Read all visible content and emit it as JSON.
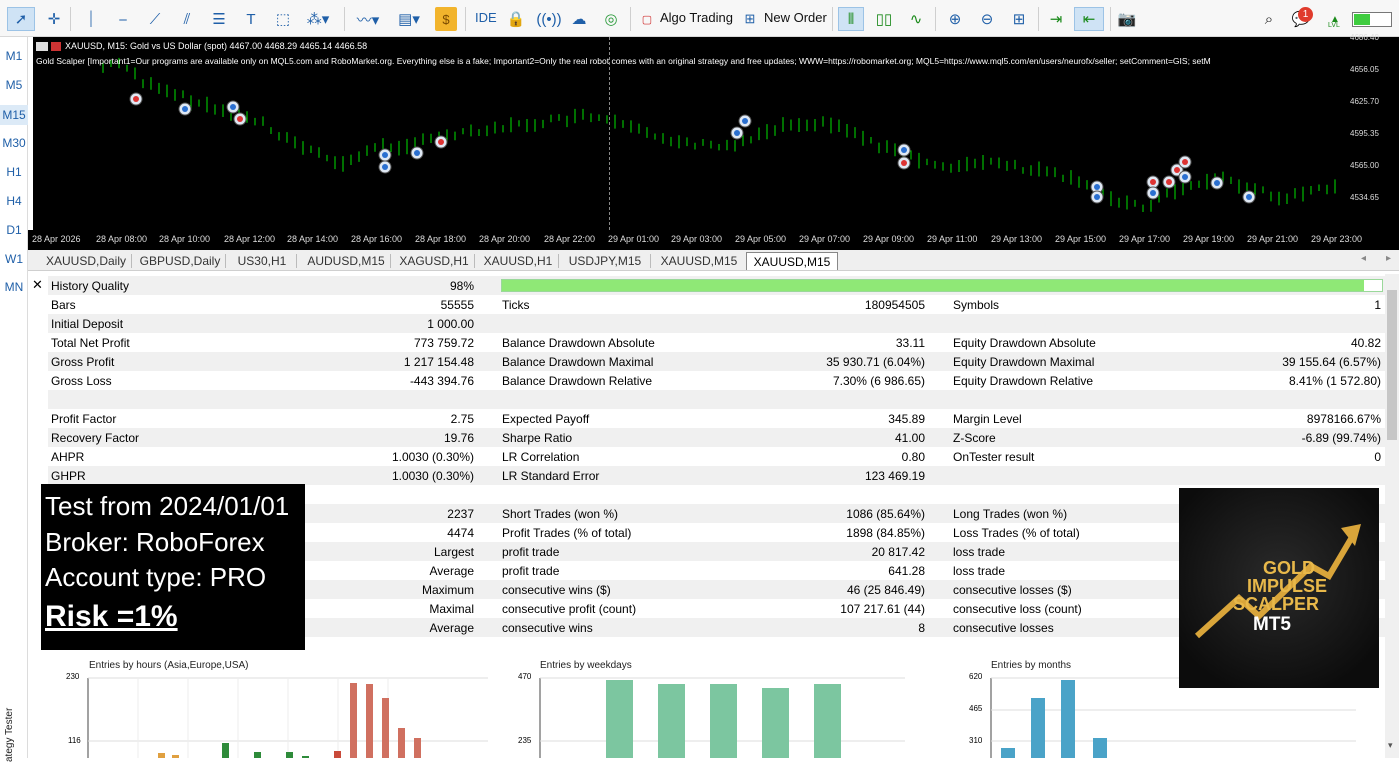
{
  "toolbar": {
    "algo_trading_label": "Algo Trading",
    "new_order_label": "New Order",
    "ide_label": "IDE",
    "notification_count": "1",
    "lvl_label": "LVL"
  },
  "timeframes": [
    "M1",
    "M5",
    "M15",
    "M30",
    "H1",
    "H4",
    "D1",
    "W1",
    "MN"
  ],
  "chart": {
    "header": "XAUUSD, M15:  Gold vs US Dollar (spot)  4467.00 4468.29 4465.14 4466.58",
    "comment": "Gold Scalper [Important1=Our programs are available only on MQL5.com and RoboMarket.org. Everything else is a fake; Important2=Only the real robot comes with an original strategy and free updates; WWW=https://robomarket.org; MQL5=https://www.mql5.com/en/users/neurofx/seller; setComment=GIS; setM",
    "prices": [
      "4686.40",
      "4656.05",
      "4625.70",
      "4595.35",
      "4565.00",
      "4534.65"
    ],
    "times": [
      "28 Apr 2026",
      "28 Apr 08:00",
      "28 Apr 10:00",
      "28 Apr 12:00",
      "28 Apr 14:00",
      "28 Apr 16:00",
      "28 Apr 18:00",
      "28 Apr 20:00",
      "28 Apr 22:00",
      "29 Apr 01:00",
      "29 Apr 03:00",
      "29 Apr 05:00",
      "29 Apr 07:00",
      "29 Apr 09:00",
      "29 Apr 11:00",
      "29 Apr 13:00",
      "29 Apr 15:00",
      "29 Apr 17:00",
      "29 Apr 19:00",
      "29 Apr 21:00",
      "29 Apr 23:00"
    ],
    "bull_color": "#00e000",
    "bg_color": "#000000"
  },
  "tabs": [
    "XAUUSD,Daily",
    "GBPUSD,Daily",
    "US30,H1",
    "AUDUSD,M15",
    "XAGUSD,H1",
    "XAUUSD,H1",
    "USDJPY,M15",
    "XAUUSD,M15",
    "XAUUSD,M15"
  ],
  "report": {
    "history_quality": {
      "label": "History Quality",
      "value": "98%",
      "fraction": 0.98
    },
    "rows": [
      {
        "c1": "Bars",
        "v1": "55555",
        "c2": "Ticks",
        "v2": "180954505",
        "c3": "Symbols",
        "v3": "1"
      },
      {
        "c1": "Initial Deposit",
        "v1": "1 000.00",
        "c2": "",
        "v2": "",
        "c3": "",
        "v3": ""
      },
      {
        "c1": "Total Net Profit",
        "v1": "773 759.72",
        "c2": "Balance Drawdown Absolute",
        "v2": "33.11",
        "c3": "Equity Drawdown Absolute",
        "v3": "40.82"
      },
      {
        "c1": "Gross Profit",
        "v1": "1 217 154.48",
        "c2": "Balance Drawdown Maximal",
        "v2": "35 930.71 (6.04%)",
        "c3": "Equity Drawdown Maximal",
        "v3": "39 155.64 (6.57%)"
      },
      {
        "c1": "Gross Loss",
        "v1": "-443 394.76",
        "c2": "Balance Drawdown Relative",
        "v2": "7.30% (6 986.65)",
        "c3": "Equity Drawdown Relative",
        "v3": "8.41% (1 572.80)"
      },
      {
        "c1": "",
        "v1": "",
        "c2": "",
        "v2": "",
        "c3": "",
        "v3": ""
      },
      {
        "c1": "Profit Factor",
        "v1": "2.75",
        "c2": "Expected Payoff",
        "v2": "345.89",
        "c3": "Margin Level",
        "v3": "8978166.67%"
      },
      {
        "c1": "Recovery Factor",
        "v1": "19.76",
        "c2": "Sharpe Ratio",
        "v2": "41.00",
        "c3": "Z-Score",
        "v3": "-6.89 (99.74%)"
      },
      {
        "c1": "AHPR",
        "v1": "1.0030 (0.30%)",
        "c2": "LR Correlation",
        "v2": "0.80",
        "c3": "OnTester result",
        "v3": "0"
      },
      {
        "c1": "GHPR",
        "v1": "1.0030 (0.30%)",
        "c2": "LR Standard Error",
        "v2": "123 469.19",
        "c3": "",
        "v3": ""
      },
      {
        "c1": "",
        "v1": "",
        "c2": "",
        "v2": "",
        "c3": "",
        "v3": ""
      },
      {
        "c1": "",
        "v1": "2237",
        "c2": "Short Trades (won %)",
        "v2": "1086 (85.64%)",
        "c3": "Long Trades (won %)",
        "v3": ""
      },
      {
        "c1": "",
        "v1": "4474",
        "c2": "Profit Trades (% of total)",
        "v2": "1898 (84.85%)",
        "c3": "Loss Trades (% of total)",
        "v3": ""
      },
      {
        "c1": "",
        "v1": "Largest",
        "c2": "profit trade",
        "v2": "20 817.42",
        "c3": "loss trade",
        "v3": ""
      },
      {
        "c1": "",
        "v1": "Average",
        "c2": "profit trade",
        "v2": "641.28",
        "c3": "loss trade",
        "v3": ""
      },
      {
        "c1": "",
        "v1": "Maximum",
        "c2": "consecutive wins ($)",
        "v2": "46 (25 846.49)",
        "c3": "consecutive losses ($)",
        "v3": ""
      },
      {
        "c1": "",
        "v1": "Maximal",
        "c2": "consecutive profit (count)",
        "v2": "107 217.61 (44)",
        "c3": "consecutive loss (count)",
        "v3": ""
      },
      {
        "c1": "",
        "v1": "Average",
        "c2": "consecutive wins",
        "v2": "8",
        "c3": "consecutive losses",
        "v3": ""
      }
    ]
  },
  "overlay": {
    "line1": "Test from 2024/01/01",
    "line2": "Broker: RoboForex",
    "line3": "Account type: PRO",
    "line4": "Risk =1%"
  },
  "logo": {
    "line1": "GOLD",
    "line2": "IMPULSE",
    "line3": "SCALPER",
    "line4": "MT5",
    "gold_color": "#e8b84a"
  },
  "mini_charts": [
    {
      "title": "Entries by hours (Asia,Europe,USA)",
      "ticks": [
        "230",
        "116"
      ]
    },
    {
      "title": "Entries by weekdays",
      "ticks": [
        "470",
        "235"
      ]
    },
    {
      "title": "Entries by months",
      "ticks": [
        "620",
        "465",
        "310"
      ]
    }
  ],
  "side_label": "ategy Tester"
}
